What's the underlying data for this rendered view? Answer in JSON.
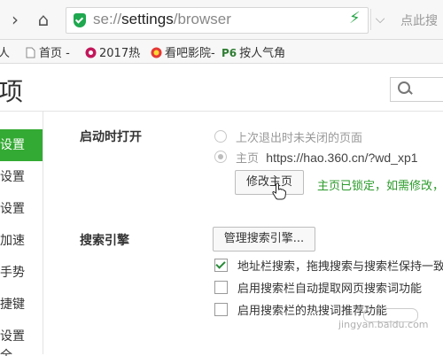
{
  "toolbar": {
    "address": {
      "domain": "se://",
      "path": "settings",
      "suffix": "/browser"
    },
    "search_hint": "点此搜"
  },
  "bookmarks": [
    {
      "label": "人",
      "icon": "partial-icon"
    },
    {
      "label": "首页 -",
      "icon": "page-icon"
    },
    {
      "label": "2017热",
      "icon": "flower-icon"
    },
    {
      "label": "看吧影院-",
      "icon": "video-icon"
    },
    {
      "label": "按人气角",
      "icon": "p6-icon"
    }
  ],
  "page": {
    "title": "项"
  },
  "sidebar": {
    "items": [
      {
        "label": "设置",
        "active": true
      },
      {
        "label": "设置"
      },
      {
        "label": "设置"
      },
      {
        "label": "加速"
      },
      {
        "label": "手势"
      },
      {
        "label": "捷键"
      },
      {
        "label": "设置"
      },
      {
        "label": "全"
      }
    ]
  },
  "startup": {
    "label": "启动时打开",
    "option_restore": "上次退出时未关闭的页面",
    "option_home": "主页",
    "home_url": "https://hao.360.cn/?wd_xp1",
    "modify_button": "修改主页",
    "lock_note": "主页已锁定，如需修改，"
  },
  "search_engine": {
    "label": "搜索引擎",
    "manage_button": "管理搜索引擎...",
    "checkboxes": [
      {
        "label": "地址栏搜索，拖拽搜索与搜索栏保持一致",
        "checked": true
      },
      {
        "label": "启用搜索栏自动提取网页搜索词功能",
        "checked": false
      },
      {
        "label": "启用搜索栏的热搜词推荐功能",
        "checked": false
      }
    ]
  },
  "watermark": {
    "text": "jingyan.baidu.com"
  },
  "colors": {
    "accent": "#33aa33",
    "lock_note": "#2a9a2a",
    "shield": "#1fa84f"
  }
}
